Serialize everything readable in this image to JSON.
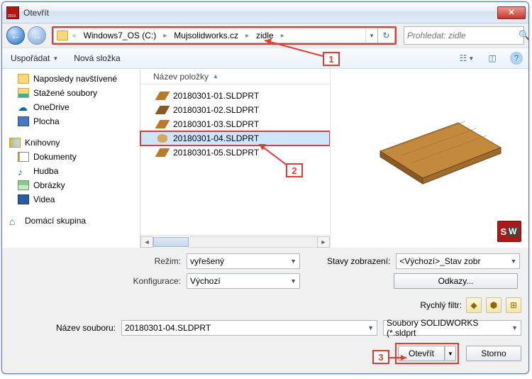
{
  "window": {
    "title": "Otevřít"
  },
  "nav": {
    "breadcrumb_prefix": "«",
    "breadcrumb": [
      "Windows7_OS (C:)",
      "Mujsolidworks.cz",
      "zidle"
    ],
    "search_placeholder": "Prohledat: zidle"
  },
  "toolbar": {
    "organize": "Uspořádat",
    "newfolder": "Nová složka"
  },
  "tree": {
    "items": [
      {
        "label": "Naposledy navštívené",
        "icon": "recent"
      },
      {
        "label": "Stažené soubory",
        "icon": "dl"
      },
      {
        "label": "OneDrive",
        "icon": "onedrive"
      },
      {
        "label": "Plocha",
        "icon": "desktop"
      }
    ],
    "libraries_label": "Knihovny",
    "libraries": [
      {
        "label": "Dokumenty",
        "icon": "doc"
      },
      {
        "label": "Hudba",
        "icon": "music"
      },
      {
        "label": "Obrázky",
        "icon": "img"
      },
      {
        "label": "Videa",
        "icon": "vid"
      }
    ],
    "homegroup_label": "Domácí skupina"
  },
  "filepane": {
    "column_header": "Název položky",
    "files": [
      "20180301-01.SLDPRT",
      "20180301-02.SLDPRT",
      "20180301-03.SLDPRT",
      "20180301-04.SLDPRT",
      "20180301-05.SLDPRT"
    ],
    "selected_index": 3
  },
  "options": {
    "mode_label": "Režim:",
    "mode_value": "vyřešený",
    "config_label": "Konfigurace:",
    "config_value": "Výchozí",
    "display_states_label": "Stavy zobrazení:",
    "display_states_value": "<Výchozí>_Stav zobr",
    "references_btn": "Odkazy...",
    "quick_filter_label": "Rychlý filtr:"
  },
  "bottom": {
    "filename_label": "Název souboru:",
    "filename_value": "20180301-04.SLDPRT",
    "filter_value": "Soubory SOLIDWORKS (*.sldprt",
    "open_btn": "Otevřít",
    "cancel_btn": "Storno"
  },
  "callouts": {
    "c1": "1",
    "c2": "2",
    "c3": "3"
  }
}
